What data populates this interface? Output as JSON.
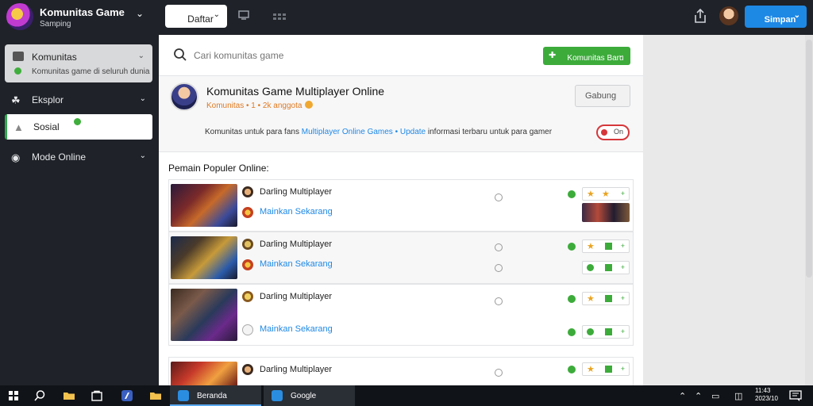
{
  "app": {
    "title": "Komunitas Game",
    "subtitle": "Samping"
  },
  "topbar": {
    "dropdown_label": "Daftar",
    "primary_label": "Simpan"
  },
  "sidebar": {
    "card": {
      "title": "Komunitas",
      "subtitle": "Komunitas game di seluruh dunia"
    },
    "items": [
      {
        "label": "Eksplor",
        "icon": "gamepad-icon"
      },
      {
        "label": "Sosial",
        "icon": "controller-icon"
      },
      {
        "label": "Mode Online",
        "icon": "globe-icon"
      }
    ]
  },
  "search": {
    "placeholder": "Cari komunitas game"
  },
  "actions": {
    "join_label": "Komunitas Baru"
  },
  "group": {
    "title": "Komunitas Game Multiplayer Online",
    "meta": "Komunitas • 1 • 2k anggota",
    "follow_label": "Gabung",
    "desc_pre": "Komunitas untuk para fans ",
    "desc_link": "Multiplayer Online Games • Update",
    "desc_post": " informasi terbaru untuk para gamer",
    "toggle_label": "On"
  },
  "section": {
    "label": "Pemain Populer Online:"
  },
  "rows": [
    {
      "name": "Darling Multiplayer",
      "link": "Mainkan Sekarang"
    },
    {
      "name": "Darling Multiplayer",
      "link": "Mainkan Sekarang"
    },
    {
      "name": "Darling Multiplayer",
      "link": "Mainkan Sekarang"
    },
    {
      "name": "Darling Multiplayer",
      "link": ""
    }
  ],
  "taskbar": {
    "apps": [
      "Beranda",
      "Google"
    ],
    "clock_time": "11:43",
    "clock_date": "2023/10"
  },
  "colors": {
    "accent": "#1e88e5",
    "success": "#3cab3a",
    "danger": "#d6373a",
    "sidebar": "#1f2228"
  }
}
